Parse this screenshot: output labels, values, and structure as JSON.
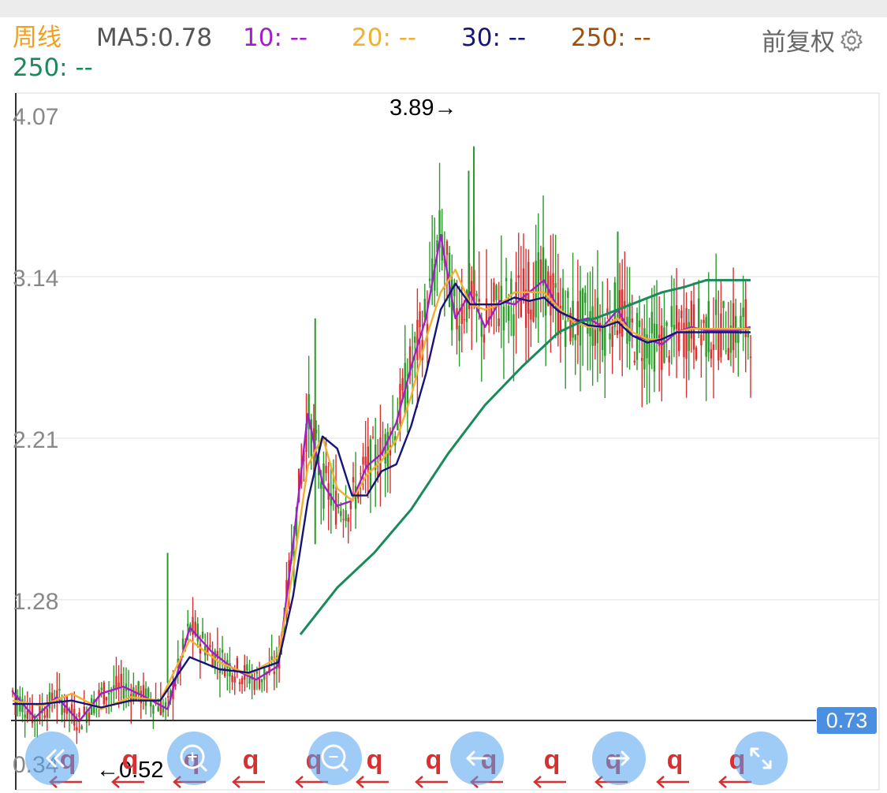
{
  "header": {
    "period_label": "周线",
    "ma5_label": "MA5:0.78",
    "ma10_label": "10: --",
    "ma20_label": "20: --",
    "ma30_label": "30: --",
    "ma250a_label": "250: --",
    "ma250b_label": "250: --",
    "adjust_label": "前复权",
    "adjust_icon": "gear-icon"
  },
  "colors": {
    "period": "#f0a020",
    "ma5": "#555555",
    "ma10": "#a020c8",
    "ma20": "#f0b030",
    "ma30": "#14147a",
    "ma250a": "#a0500a",
    "ma250b": "#1a8a5a",
    "up": "#d83030",
    "down": "#2a9a2a",
    "price_tag_bg": "#4a8fe0"
  },
  "annotations": {
    "high_label": "3.89→",
    "low_label": "←0.52",
    "current_price_tag": "0.73"
  },
  "toolbar": {
    "icons": [
      "rewind-icon",
      "zoom-in-icon",
      "zoom-out-icon",
      "scroll-left-icon",
      "scroll-right-icon",
      "fullscreen-icon"
    ],
    "markers": [
      "q",
      "q",
      "q",
      "q",
      "q",
      "q",
      "q",
      "q",
      "q",
      "q",
      "q",
      "q"
    ]
  },
  "chart_data": {
    "type": "line",
    "title": "",
    "xlabel": "",
    "ylabel": "",
    "y_ticks": [
      "4.07",
      "3.14",
      "2.21",
      "1.28",
      "0.34"
    ],
    "ylim": [
      0.34,
      4.07
    ],
    "x_range": [
      0,
      100
    ],
    "current_price": 0.73,
    "high": 3.89,
    "low": 0.52,
    "grid": true,
    "series": [
      {
        "key": "ma10",
        "x": [
          0,
          3,
          6,
          9,
          12,
          15,
          18,
          21,
          24,
          27,
          30,
          33,
          36,
          38,
          40,
          42,
          44,
          46,
          48,
          50,
          52,
          54,
          56,
          58,
          60,
          62,
          64,
          66,
          68,
          70,
          72,
          74,
          76,
          78,
          80,
          82,
          84,
          86,
          88,
          90,
          92,
          94,
          96,
          98,
          100
        ],
        "y": [
          0.75,
          0.6,
          0.72,
          0.58,
          0.74,
          0.78,
          0.72,
          0.65,
          1.12,
          0.98,
          0.88,
          0.82,
          0.9,
          1.6,
          2.35,
          1.95,
          1.82,
          1.85,
          2.05,
          2.12,
          2.3,
          2.62,
          2.9,
          3.38,
          2.9,
          3.05,
          2.85,
          3.0,
          2.98,
          3.05,
          3.12,
          2.95,
          2.88,
          2.9,
          2.85,
          2.95,
          2.8,
          2.78,
          2.75,
          2.82,
          2.85,
          2.83,
          2.83,
          2.83,
          2.85
        ]
      },
      {
        "key": "ma20",
        "x": [
          0,
          4,
          8,
          12,
          16,
          20,
          24,
          28,
          32,
          36,
          38,
          40,
          42,
          44,
          46,
          48,
          50,
          52,
          54,
          56,
          58,
          60,
          62,
          64,
          66,
          68,
          70,
          72,
          74,
          76,
          78,
          80,
          82,
          84,
          86,
          88,
          90,
          92,
          94,
          96,
          98,
          100
        ],
        "y": [
          0.7,
          0.67,
          0.74,
          0.65,
          0.72,
          0.7,
          1.05,
          0.92,
          0.85,
          0.95,
          1.45,
          2.05,
          2.22,
          1.92,
          1.85,
          2.0,
          2.08,
          2.2,
          2.45,
          2.78,
          3.05,
          3.18,
          2.98,
          2.95,
          2.98,
          3.05,
          3.05,
          3.05,
          2.96,
          2.88,
          2.85,
          2.85,
          2.9,
          2.82,
          2.78,
          2.78,
          2.82,
          2.84,
          2.84,
          2.84,
          2.84,
          2.84
        ]
      },
      {
        "key": "ma30",
        "x": [
          0,
          4,
          8,
          12,
          16,
          20,
          24,
          28,
          32,
          36,
          38,
          40,
          42,
          44,
          46,
          48,
          50,
          52,
          54,
          56,
          58,
          60,
          62,
          64,
          66,
          68,
          70,
          72,
          74,
          76,
          78,
          80,
          82,
          84,
          86,
          88,
          90,
          92,
          94,
          96,
          98,
          100
        ],
        "y": [
          0.68,
          0.68,
          0.7,
          0.66,
          0.7,
          0.7,
          0.95,
          0.88,
          0.86,
          0.92,
          1.3,
          1.85,
          2.22,
          2.15,
          1.88,
          1.88,
          2.02,
          2.06,
          2.28,
          2.58,
          2.95,
          3.1,
          2.98,
          2.98,
          2.98,
          3.02,
          3.0,
          3.02,
          2.94,
          2.9,
          2.86,
          2.85,
          2.88,
          2.8,
          2.76,
          2.78,
          2.82,
          2.82,
          2.82,
          2.82,
          2.82,
          2.82
        ]
      },
      {
        "key": "ma250b",
        "x": [
          39,
          44,
          49,
          54,
          59,
          64,
          69,
          74,
          77,
          79,
          82,
          85,
          88,
          91,
          94,
          97,
          100
        ],
        "y": [
          1.08,
          1.35,
          1.55,
          1.8,
          2.12,
          2.4,
          2.62,
          2.82,
          2.88,
          2.9,
          2.95,
          3.0,
          3.05,
          3.08,
          3.12,
          3.12,
          3.12
        ]
      }
    ]
  }
}
